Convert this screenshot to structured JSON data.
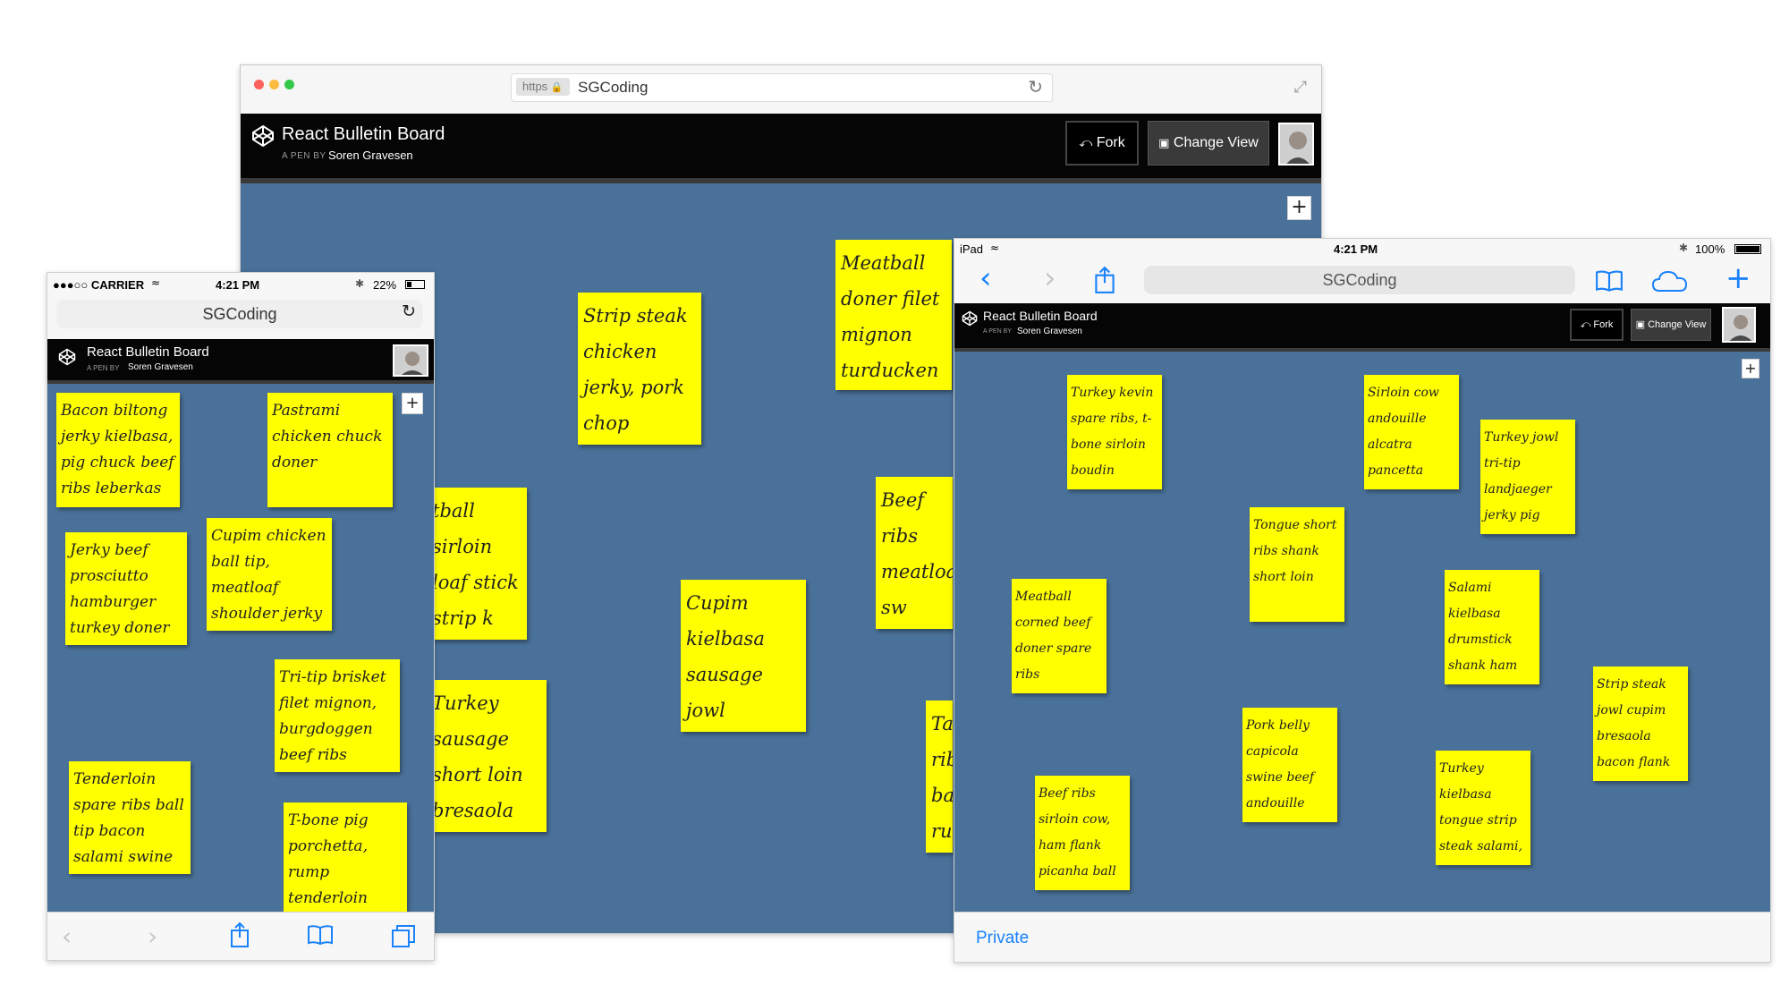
{
  "colors": {
    "board": "#4a7199",
    "note": "#ffff00",
    "header": "#050505",
    "ios_blue": "#1a82fb"
  },
  "desktop": {
    "https_label": "https",
    "url_text": "SGCoding",
    "pen_title": "React Bulletin Board",
    "pen_by": "A PEN BY",
    "author": "Soren Gravesen",
    "fork_label": "Fork",
    "change_view_label": "Change View",
    "add_label": "+",
    "notes": [
      "Meatball doner filet mignon turducken ham brisket",
      "Strip steak chicken jerky, pork chop landjaeger spare",
      "tball sirloin loaf stick strip k pork chop",
      "Beef ribs meatloaf sw boudin frankfurte",
      "Cupim kielbasa sausage jowl frankfurter beef burgdoggen",
      "Turkey sausage short loin bresaola alcatra burgdoggen",
      "Tai ribe ball rum"
    ]
  },
  "phone": {
    "carrier": "●●●○○ CARRIER",
    "time": "4:21 PM",
    "battery": "22%",
    "url_text": "SGCoding",
    "pen_title": "React Bulletin Board",
    "pen_by": "A PEN BY",
    "author": "Soren Gravesen",
    "add_label": "+",
    "notes": [
      "Bacon biltong jerky kielbasa, pig chuck beef ribs leberkas",
      "Pastrami chicken chuck doner",
      "Jerky beef prosciutto hamburger turkey doner",
      "Cupim chicken ball tip, meatloaf shoulder jerky tenderloin corned",
      "Tri-tip brisket filet mignon, burgdoggen beef ribs alcatra",
      "Tenderloin spare ribs ball tip bacon salami swine beef ribs",
      "T-bone pig porchetta, rump tenderloin hamburger"
    ]
  },
  "tablet": {
    "device": "iPad",
    "time": "4:21 PM",
    "battery": "100%",
    "url_text": "SGCoding",
    "pen_title": "React Bulletin Board",
    "pen_by": "A PEN BY",
    "author": "Soren Gravesen",
    "fork_label": "Fork",
    "change_view_label": "Change View",
    "add_label": "+",
    "private_label": "Private",
    "notes": [
      "Turkey kevin spare ribs, t-bone sirloin boudin bresaola",
      "Sirloin cow andouille alcatra pancetta pork loin venison beef",
      "Turkey jowl tri-tip landjaeger jerky pig meatloaf",
      "Tongue short ribs shank short loin",
      "Meatball corned beef doner spare ribs frankfurter,",
      "Salami kielbasa drumstick shank ham strip steak swine",
      "Strip steak jowl cupim bresaola bacon flank ground round",
      "Pork belly capicola swine beef andouille cupim t-bone",
      "Turkey kielbasa tongue strip steak salami, sausage pig",
      "Beef ribs sirloin cow, ham flank picanha ball tip"
    ]
  }
}
